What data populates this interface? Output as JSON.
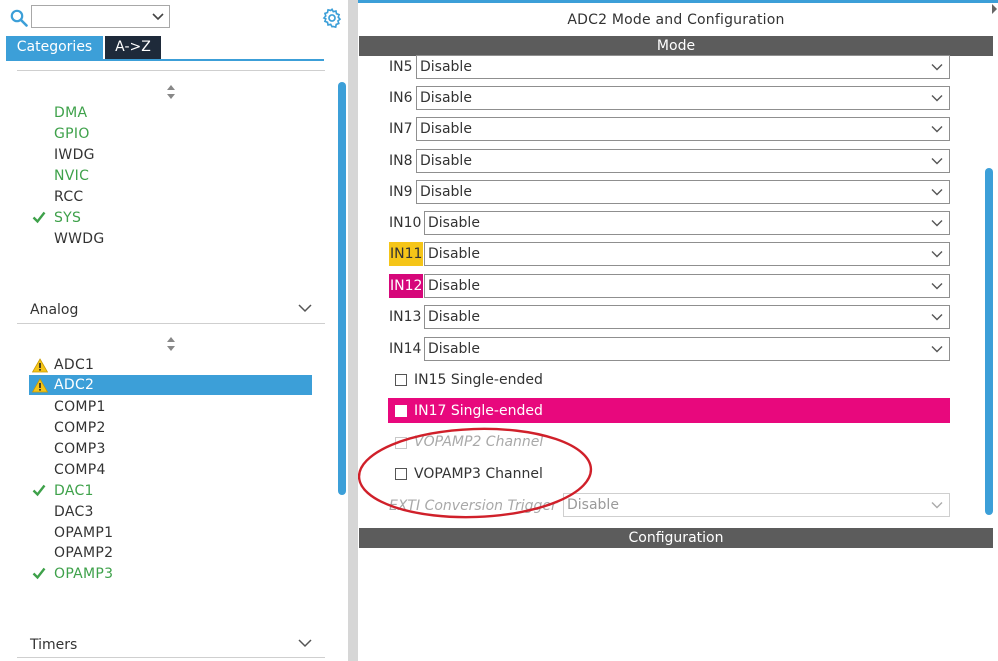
{
  "left_panel": {
    "search": {
      "value": ""
    },
    "tabs": [
      {
        "label": "Categories",
        "active": true
      },
      {
        "label": "A->Z",
        "active": false
      }
    ],
    "system_core_items": [
      {
        "label": "DMA",
        "status": "enabled",
        "color": "green"
      },
      {
        "label": "GPIO",
        "status": "enabled",
        "color": "green"
      },
      {
        "label": "IWDG",
        "status": "none",
        "color": "dark"
      },
      {
        "label": "NVIC",
        "status": "enabled",
        "color": "green"
      },
      {
        "label": "RCC",
        "status": "none",
        "color": "dark"
      },
      {
        "label": "SYS",
        "status": "checked",
        "color": "green"
      },
      {
        "label": "WWDG",
        "status": "none",
        "color": "dark"
      }
    ],
    "categories": [
      {
        "label": "Analog"
      },
      {
        "label": "Timers"
      }
    ],
    "analog_items": [
      {
        "label": "ADC1",
        "status": "warning",
        "color": "dark"
      },
      {
        "label": "ADC2",
        "status": "warning",
        "color": "dark",
        "selected": true
      },
      {
        "label": "COMP1",
        "status": "none",
        "color": "dark"
      },
      {
        "label": "COMP2",
        "status": "none",
        "color": "dark"
      },
      {
        "label": "COMP3",
        "status": "none",
        "color": "dark"
      },
      {
        "label": "COMP4",
        "status": "none",
        "color": "dark"
      },
      {
        "label": "DAC1",
        "status": "checked",
        "color": "green"
      },
      {
        "label": "DAC3",
        "status": "none",
        "color": "dark"
      },
      {
        "label": "OPAMP1",
        "status": "none",
        "color": "dark"
      },
      {
        "label": "OPAMP2",
        "status": "none",
        "color": "dark"
      },
      {
        "label": "OPAMP3",
        "status": "checked",
        "color": "green"
      }
    ]
  },
  "right_panel": {
    "title": "ADC2 Mode and Configuration",
    "mode_header": "Mode",
    "config_header": "Configuration",
    "inputs": [
      {
        "label": "IN5",
        "value": "Disable",
        "highlight": "none"
      },
      {
        "label": "IN6",
        "value": "Disable",
        "highlight": "none"
      },
      {
        "label": "IN7",
        "value": "Disable",
        "highlight": "none"
      },
      {
        "label": "IN8",
        "value": "Disable",
        "highlight": "none"
      },
      {
        "label": "IN9",
        "value": "Disable",
        "highlight": "none"
      },
      {
        "label": "IN10",
        "value": "Disable",
        "highlight": "none"
      },
      {
        "label": "IN11",
        "value": "Disable",
        "highlight": "yellow"
      },
      {
        "label": "IN12",
        "value": "Disable",
        "highlight": "pink"
      },
      {
        "label": "IN13",
        "value": "Disable",
        "highlight": "none"
      },
      {
        "label": "IN14",
        "value": "Disable",
        "highlight": "none"
      }
    ],
    "checkboxes": [
      {
        "label": "IN15 Single-ended",
        "checked": false,
        "enabled": true
      },
      {
        "label": "IN17 Single-ended",
        "checked": false,
        "enabled": true,
        "highlight": "pink"
      },
      {
        "label": "VOPAMP2 Channel",
        "checked": false,
        "enabled": false
      },
      {
        "label": "VOPAMP3 Channel",
        "checked": false,
        "enabled": true
      }
    ],
    "ext_trigger": {
      "label": "EXTI Conversion Trigger",
      "value": "Disable",
      "enabled": false
    }
  },
  "colors": {
    "accent_blue": "#3c9fd8",
    "green": "#3ea14a",
    "yellow_highlight": "#f5c518",
    "pink_highlight": "#e8087d",
    "header_gray": "#5c5c5c",
    "annotation_red": "#d0202a"
  },
  "icons": {
    "search": "search-icon",
    "settings": "gear-icon",
    "check": "check-icon",
    "warning": "warning-icon",
    "chevron": "chevron-down-icon",
    "sort": "sort-arrows-icon"
  }
}
